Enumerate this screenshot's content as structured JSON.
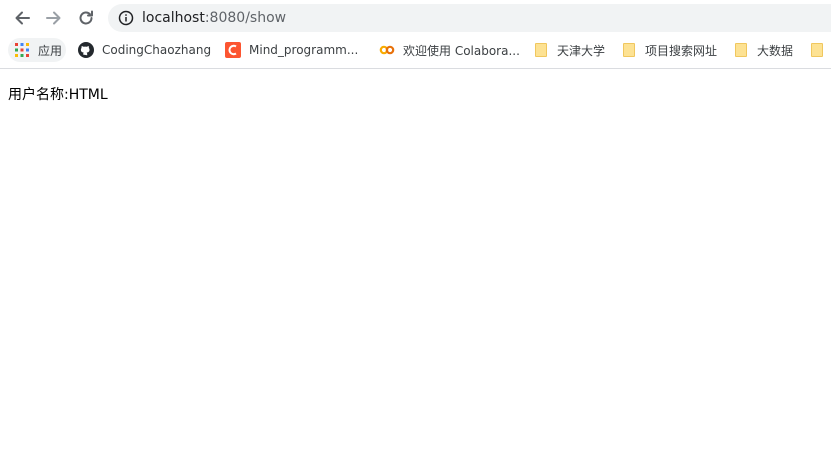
{
  "browser": {
    "url_host": "localhost",
    "url_rest": ":8080/show",
    "bookmarks": [
      {
        "label": "应用",
        "icon": "apps-grid-icon"
      },
      {
        "label": "CodingChaozhang",
        "icon": "github-icon"
      },
      {
        "label": "Mind_programm...",
        "icon": "csdn-icon"
      },
      {
        "label": "欢迎使用 Colabora...",
        "icon": "colab-icon"
      },
      {
        "label": "天津大学",
        "icon": "folder-icon"
      },
      {
        "label": "项目搜索网址",
        "icon": "folder-icon"
      },
      {
        "label": "大数据",
        "icon": "folder-icon"
      },
      {
        "label": "",
        "icon": "folder-icon"
      }
    ]
  },
  "page": {
    "username_label": "用户名称:",
    "username_value": "HTML"
  },
  "colors": {
    "accent_csdn": "#fc5531",
    "colab_orange": "#f9ab00",
    "folder_yellow": "#fde293"
  }
}
